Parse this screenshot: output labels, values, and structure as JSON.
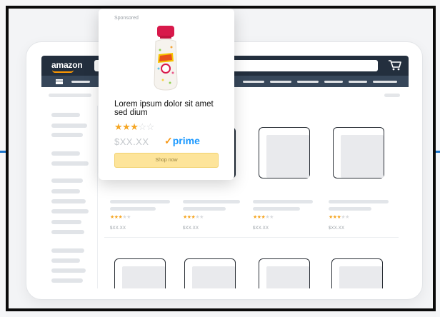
{
  "header": {
    "logo": "amazon"
  },
  "popup": {
    "sponsored_label": "Sponsored",
    "product_title": "Lorem ipsum dolor sit amet sed dium",
    "rating": {
      "filled": "★★★",
      "empty": "☆☆"
    },
    "price": "$XX.XX",
    "prime_check": "✓",
    "prime_label": "prime",
    "shop_button": "Shop now"
  },
  "products": [
    {
      "stars_filled": "★★★",
      "stars_empty": "★★",
      "price": "$XX.XX"
    },
    {
      "stars_filled": "★★★",
      "stars_empty": "★★",
      "price": "$XX.XX"
    },
    {
      "stars_filled": "★★★",
      "stars_empty": "★★",
      "price": "$XX.XX"
    },
    {
      "stars_filled": "★★★",
      "stars_empty": "★★",
      "price": "$XX.XX"
    }
  ],
  "colors": {
    "topbar": "#232f3e",
    "subbar": "#37475a",
    "accent_orange": "#ff9900",
    "prime_blue": "#1a98ff",
    "shop_button": "#fde49a",
    "guide_line": "#1a73c9"
  },
  "icons": {
    "cart": "cart-icon",
    "menu": "menu-icon"
  }
}
